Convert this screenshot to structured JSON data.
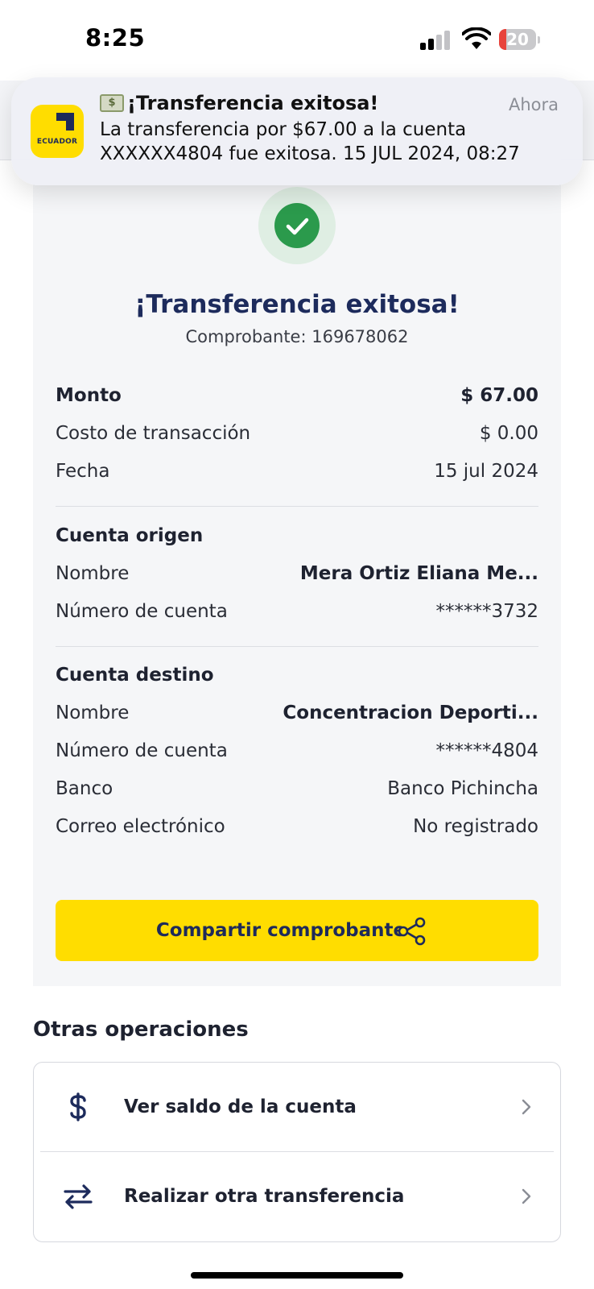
{
  "status_bar": {
    "time": "8:25",
    "battery_level": "20",
    "battery_fraction": 0.2,
    "battery_color": "#e8433b"
  },
  "notification": {
    "app_icon": "banco-ecuador-logo",
    "brand_text": "ECUADOR",
    "title": "¡Transferencia exitosa!",
    "title_icon": "dollar-banknote-emoji",
    "time": "Ahora",
    "body": "La transferencia por $67.00 a la cuenta XXXXXX4804 fue exitosa. 15 JUL 2024, 08:27"
  },
  "receipt": {
    "status_icon": "checkmark-circle-icon",
    "title": "¡Transferencia exitosa!",
    "voucher": "Comprobante: 169678062",
    "summary": [
      {
        "label": "Monto",
        "value": "$ 67.00"
      },
      {
        "label": "Costo de transacción",
        "value": "$ 0.00"
      },
      {
        "label": "Fecha",
        "value": "15 jul 2024"
      }
    ],
    "origin": {
      "title": "Cuenta origen",
      "rows": [
        {
          "label": "Nombre",
          "value": "Mera  Ortiz Eliana Me..."
        },
        {
          "label": "Número de cuenta",
          "value": "******3732"
        }
      ]
    },
    "destination": {
      "title": "Cuenta destino",
      "rows": [
        {
          "label": "Nombre",
          "value": "Concentracion Deporti..."
        },
        {
          "label": "Número de cuenta",
          "value": "******4804"
        },
        {
          "label": "Banco",
          "value": "Banco Pichincha"
        },
        {
          "label": "Correo electrónico",
          "value": "No registrado"
        }
      ]
    },
    "share_button": {
      "label": "Compartir comprobante",
      "icon": "share-icon"
    }
  },
  "other_operations": {
    "title": "Otras operaciones",
    "items": [
      {
        "label": "Ver saldo de la cuenta",
        "icon": "dollar-sign-icon"
      },
      {
        "label": "Realizar otra transferencia",
        "icon": "transfer-arrows-icon"
      }
    ]
  },
  "colors": {
    "brand_yellow": "#ffdd00",
    "brand_navy": "#1d2b5c",
    "success_green": "#2b9a4c"
  }
}
